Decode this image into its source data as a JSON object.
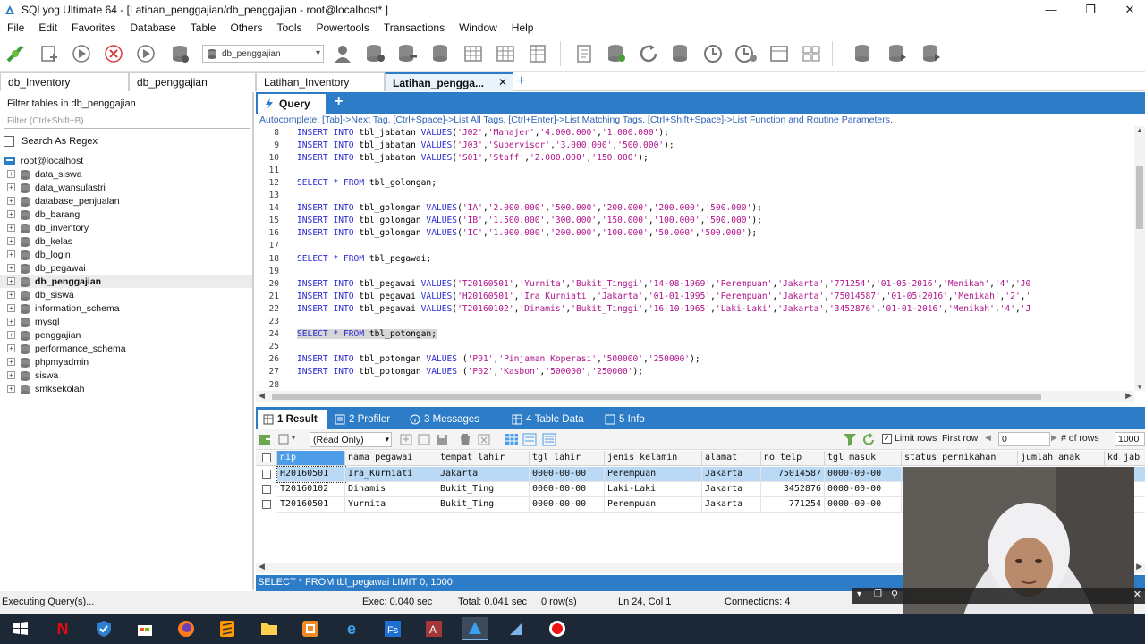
{
  "window": {
    "title": "SQLyog Ultimate 64 - [Latihan_penggajian/db_penggajian - root@localhost* ]"
  },
  "menu": [
    "File",
    "Edit",
    "Favorites",
    "Database",
    "Table",
    "Others",
    "Tools",
    "Powertools",
    "Transactions",
    "Window",
    "Help"
  ],
  "toolbar": {
    "database_select": "db_penggajian"
  },
  "connection_tabs": [
    "db_Inventory",
    "db_penggajian",
    "Latihan_Inventory",
    "Latihan_pengga..."
  ],
  "left_panel": {
    "header": "Filter tables in db_penggajian",
    "filter_placeholder": "Filter (Ctrl+Shift+B)",
    "regex_label": "Search As Regex",
    "root": "root@localhost",
    "databases": [
      "data_siswa",
      "data_wansulastri",
      "database_penjualan",
      "db_barang",
      "db_inventory",
      "db_kelas",
      "db_login",
      "db_pegawai",
      "db_penggajian",
      "db_siswa",
      "information_schema",
      "mysql",
      "penggajian",
      "performance_schema",
      "phpmyadmin",
      "siswa",
      "smksekolah"
    ],
    "selected_database": "db_penggajian"
  },
  "query_tab": {
    "label": "Query"
  },
  "autocomplete_hint": "Autocomplete: [Tab]->Next Tag. [Ctrl+Space]->List All Tags. [Ctrl+Enter]->List Matching Tags. [Ctrl+Shift+Space]->List Function and Routine Parameters.",
  "editor": {
    "lines": [
      {
        "n": "8",
        "text": "INSERT INTO tbl_jabatan VALUES('J02','Manajer','4.000.000','1.000.000');"
      },
      {
        "n": "9",
        "text": "INSERT INTO tbl_jabatan VALUES('J03','Supervisor','3.000.000','500.000');"
      },
      {
        "n": "10",
        "text": "INSERT INTO tbl_jabatan VALUES('S01','Staff','2.000.000','150.000');"
      },
      {
        "n": "11",
        "text": ""
      },
      {
        "n": "12",
        "text": "SELECT * FROM tbl_golongan;"
      },
      {
        "n": "13",
        "text": ""
      },
      {
        "n": "14",
        "text": "INSERT INTO tbl_golongan VALUES('IA','2.000.000','500.000','200.000','200.000','500.000');"
      },
      {
        "n": "15",
        "text": "INSERT INTO tbl_golongan VALUES('IB','1.500.000','300.000','150.000','100.000','500.000');"
      },
      {
        "n": "16",
        "text": "INSERT INTO tbl_golongan VALUES('IC','1.000.000','200.000','100.000','50.000','500.000');"
      },
      {
        "n": "17",
        "text": ""
      },
      {
        "n": "18",
        "text": "SELECT * FROM tbl_pegawai;"
      },
      {
        "n": "19",
        "text": ""
      },
      {
        "n": "20",
        "text": "INSERT INTO tbl_pegawai VALUES('T20160501','Yurnita','Bukit_Tinggi','14-08-1969','Perempuan','Jakarta','771254','01-05-2016','Menikah','4','J0"
      },
      {
        "n": "21",
        "text": "INSERT INTO tbl_pegawai VALUES('H20160501','Ira_Kurniati','Jakarta','01-01-1995','Perempuan','Jakarta','75014587','01-05-2016','Menikah','2','"
      },
      {
        "n": "22",
        "text": "INSERT INTO tbl_pegawai VALUES('T20160102','Dinamis','Bukit_Tinggi','16-10-1965','Laki-Laki','Jakarta','3452876','01-01-2016','Menikah','4','J"
      },
      {
        "n": "23",
        "text": ""
      },
      {
        "n": "24",
        "text": "SELECT * FROM tbl_potongan;"
      },
      {
        "n": "25",
        "text": ""
      },
      {
        "n": "26",
        "text": "INSERT INTO tbl_potongan VALUES ('P01','Pinjaman Koperasi','500000','250000');"
      },
      {
        "n": "27",
        "text": "INSERT INTO tbl_potongan VALUES ('P02','Kasbon','500000','250000');"
      },
      {
        "n": "28",
        "text": ""
      }
    ],
    "selected_line": "24"
  },
  "result_tabs": [
    {
      "num": "1",
      "label": "Result"
    },
    {
      "num": "2",
      "label": "Profiler"
    },
    {
      "num": "3",
      "label": "Messages"
    },
    {
      "num": "4",
      "label": "Table Data"
    },
    {
      "num": "5",
      "label": "Info"
    }
  ],
  "result_toolbar": {
    "mode": "(Read Only)",
    "limit_rows_label": "Limit rows",
    "first_row_label": "First row",
    "first_row_value": "0",
    "num_rows_label": "# of rows",
    "num_rows_value": "1000"
  },
  "grid": {
    "columns": [
      "nip",
      "nama_pegawai",
      "tempat_lahir",
      "tgl_lahir",
      "jenis_kelamin",
      "alamat",
      "no_telp",
      "tgl_masuk",
      "status_pernikahan",
      "jumlah_anak",
      "kd_jab"
    ],
    "rows": [
      [
        "H20160501",
        "Ira_Kurniati",
        "Jakarta",
        "0000-00-00",
        "Perempuan",
        "Jakarta",
        "75014587",
        "0000-00-00",
        "",
        "",
        ""
      ],
      [
        "T20160102",
        "Dinamis",
        "Bukit_Ting",
        "0000-00-00",
        "Laki-Laki",
        "Jakarta",
        "3452876",
        "0000-00-00",
        "",
        "",
        ""
      ],
      [
        "T20160501",
        "Yurnita",
        "Bukit_Ting",
        "0000-00-00",
        "Perempuan",
        "Jakarta",
        "771254",
        "0000-00-00",
        "",
        "",
        ""
      ]
    ]
  },
  "sql_status": "SELECT * FROM tbl_pegawai LIMIT 0, 1000",
  "status_bar": {
    "state": "Executing Query(s)...",
    "exec": "Exec: 0.040 sec",
    "total": "Total: 0.041 sec",
    "rows": "0 row(s)",
    "position": "Ln 24, Col 1",
    "connections": "Connections: 4"
  },
  "colors": {
    "accent": "#2d7cc8",
    "keyword": "#2a2ad0",
    "string": "#b0138a"
  }
}
